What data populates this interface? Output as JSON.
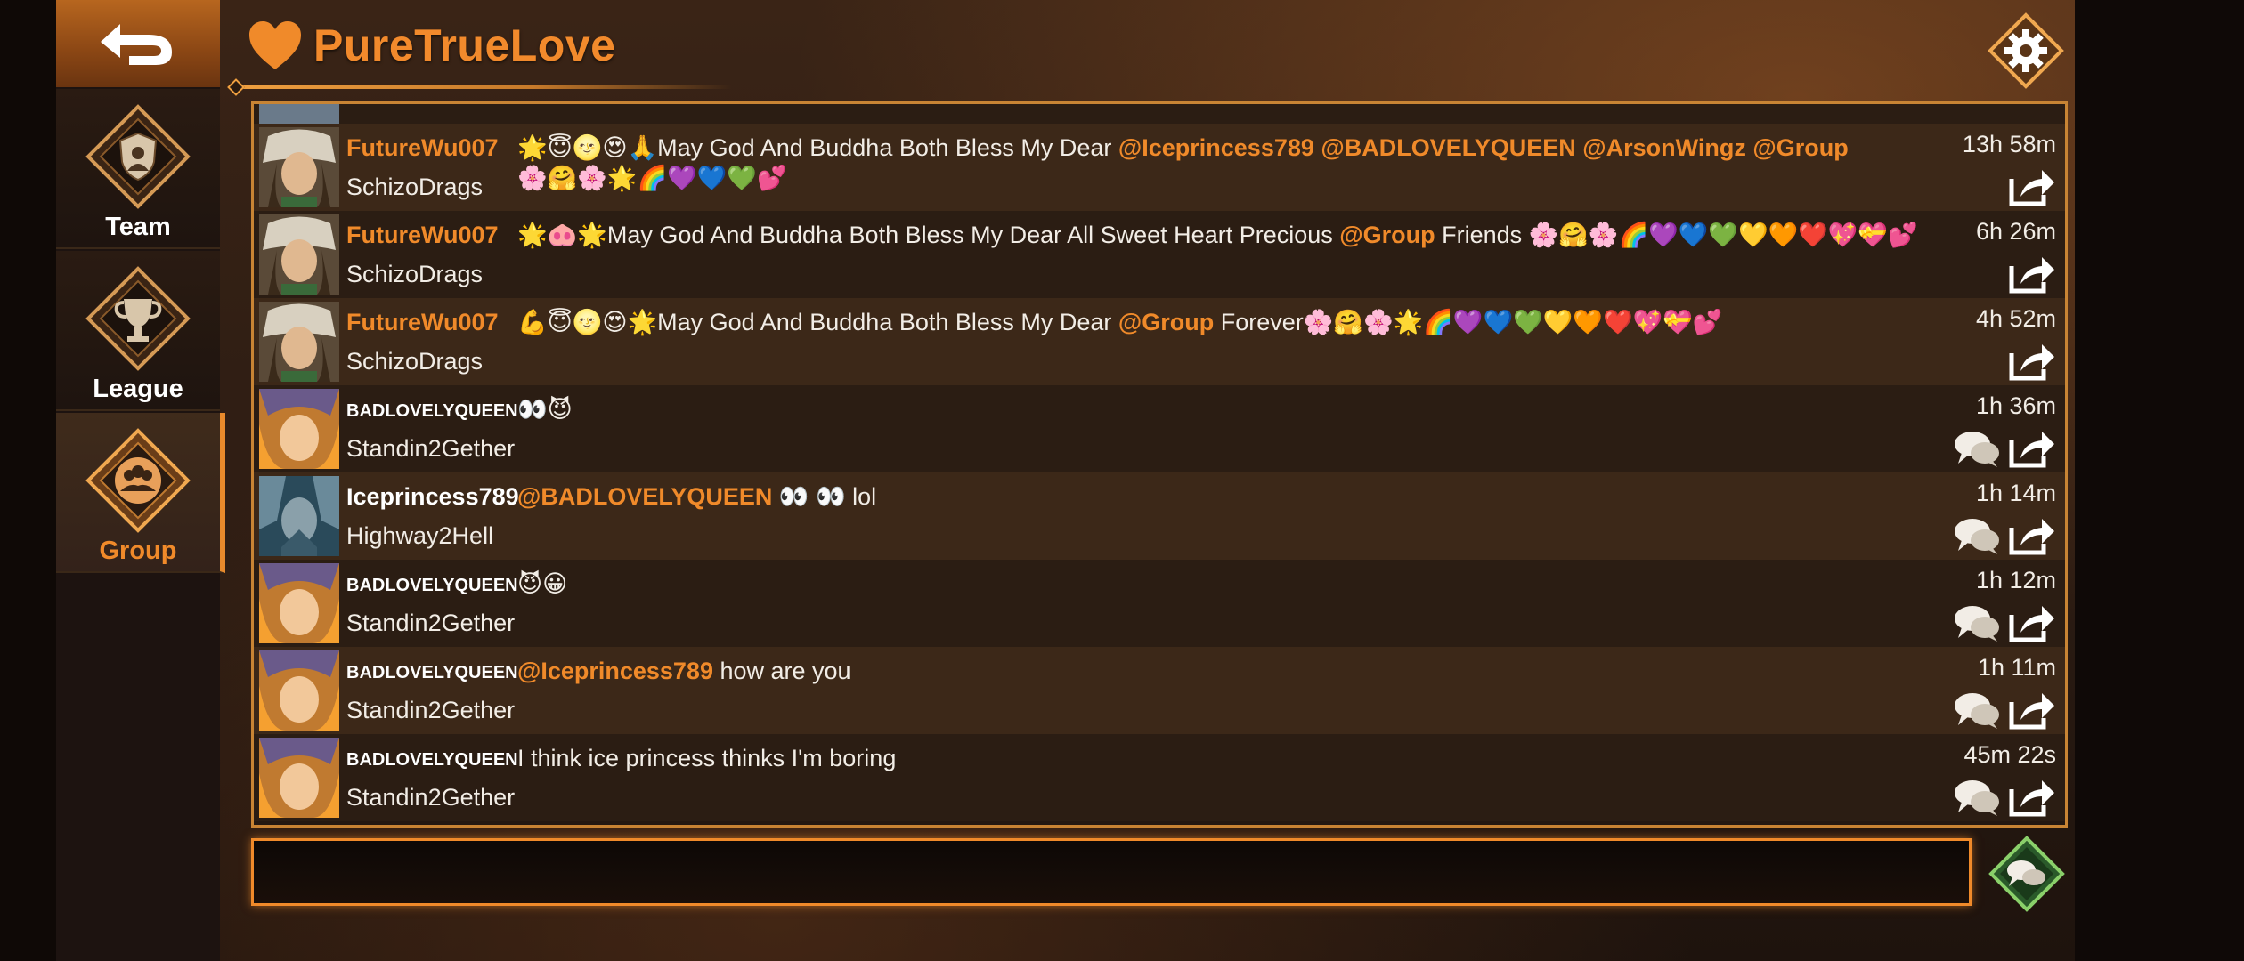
{
  "header": {
    "title": "PureTrueLove",
    "heart_icon": "heart-icon",
    "settings_icon": "gear-icon"
  },
  "sidebar": {
    "back_icon": "back-arrow-icon",
    "items": [
      {
        "label": "Team",
        "icon": "team-shield-icon",
        "active": false
      },
      {
        "label": "League",
        "icon": "trophy-icon",
        "active": false
      },
      {
        "label": "Group",
        "icon": "group-chat-icon",
        "active": true
      }
    ]
  },
  "chat": {
    "messages": [
      {
        "user": "FutureWu007",
        "guild": "SchizoDrags",
        "text_parts": [
          "🌟😇🌝😍🙏May God And Buddha Both Bless My Dear "
        ],
        "mentions": [
          "@Iceprincess789",
          "@BADLOVELYQUEEN",
          "@ArsonWingz",
          "@Group"
        ],
        "text_tail": "🌸🤗🌸🌟🌈💜💙💚💕",
        "time": "13h 58m",
        "has_reply": false
      },
      {
        "user": "FutureWu007",
        "guild": "SchizoDrags",
        "text_before": "🌟🐽🌟May God And Buddha Both Bless My Dear All Sweet Heart Precious ",
        "mention": "@Group",
        "text_after": " Friends 🌸🤗🌸🌈💜💙💚💛🧡❤️💖💝💕",
        "time": "6h 26m",
        "has_reply": false
      },
      {
        "user": "FutureWu007",
        "guild": "SchizoDrags",
        "text_before": "💪😇🌝😍🌟May God And Buddha Both Bless My Dear ",
        "mention": "@Group",
        "text_after": " Forever🌸🤗🌸🌟🌈💜💙💚💛🧡❤️💖💝💕",
        "time": "4h 52m",
        "has_reply": false
      },
      {
        "user": "BADLOVELYQUEEN",
        "guild": "Standin2Gether",
        "text_before": "👀😈",
        "mention": "",
        "text_after": "",
        "time": "1h 36m",
        "has_reply": true
      },
      {
        "user": "Iceprincess789",
        "guild": "Highway2Hell",
        "text_before": "",
        "mention": "@BADLOVELYQUEEN",
        "text_after": "  👀  👀  lol",
        "time": "1h 14m",
        "has_reply": true
      },
      {
        "user": "BADLOVELYQUEEN",
        "guild": "Standin2Gether",
        "text_before": "😈😀",
        "mention": "",
        "text_after": "",
        "time": "1h 12m",
        "has_reply": true
      },
      {
        "user": "BADLOVELYQUEEN",
        "guild": "Standin2Gether",
        "text_before": "",
        "mention": "@Iceprincess789",
        "text_after": " how are you",
        "time": "1h 11m",
        "has_reply": true
      },
      {
        "user": "BADLOVELYQUEEN",
        "guild": "Standin2Gether",
        "text_before": "I think ice princess thinks I'm boring",
        "mention": "",
        "text_after": "",
        "time": "45m 22s",
        "has_reply": true
      }
    ]
  },
  "input": {
    "value": "",
    "placeholder": ""
  },
  "colors": {
    "accent": "#f08a2a",
    "panel_border": "#c88434",
    "row_a": "#3c2818",
    "row_b": "#2b1d13"
  }
}
